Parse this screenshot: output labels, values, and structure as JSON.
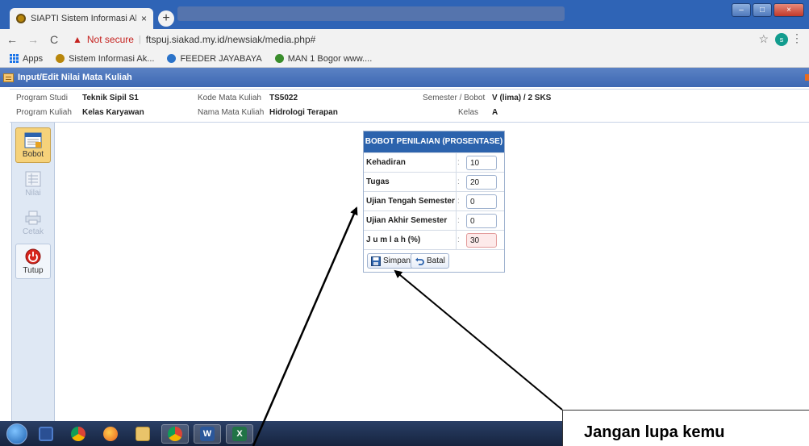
{
  "browser": {
    "tab_title": "SIAPTI Sistem Informasi Akadem",
    "tab_close": "×",
    "new_tab": "+",
    "not_secure": "Not secure",
    "url": "ftspuj.siakad.my.id/newsiak/media.php#",
    "profile_initial": "s",
    "window_buttons": {
      "minimize": "–",
      "maximize": "□",
      "close": "×"
    }
  },
  "bookmarks": [
    {
      "label": "Apps",
      "icon": "apps-icon"
    },
    {
      "label": "Sistem Informasi Ak...",
      "icon": "siakad-icon",
      "color": "#b8860b"
    },
    {
      "label": "FEEDER JAYABAYA",
      "icon": "feeder-icon",
      "color": "#2b73c9"
    },
    {
      "label": "MAN 1 Bogor www....",
      "icon": "man-icon",
      "color": "#3a8d2c"
    }
  ],
  "app": {
    "window_title": "Input/Edit Nilai Mata Kuliah"
  },
  "info": {
    "program_studi_label": "Program Studi",
    "program_studi": "Teknik Sipil S1",
    "program_kuliah_label": "Program Kuliah",
    "program_kuliah": "Kelas Karyawan",
    "kode_mk_label": "Kode Mata Kuliah",
    "kode_mk": "TS5022",
    "nama_mk_label": "Nama Mata Kuliah",
    "nama_mk": "Hidrologi Terapan",
    "semester_label": "Semester / Bobot",
    "semester": "V (lima) / 2 SKS",
    "kelas_label": "Kelas",
    "kelas": "A"
  },
  "sidebar": {
    "items": [
      {
        "label": "Bobot",
        "icon": "weight-icon",
        "state": "active"
      },
      {
        "label": "Nilai",
        "icon": "grades-icon",
        "state": "disabled"
      },
      {
        "label": "Cetak",
        "icon": "printer-icon",
        "state": "disabled"
      },
      {
        "label": "Tutup",
        "icon": "power-icon",
        "state": "normal"
      }
    ]
  },
  "bobot": {
    "header": "BOBOT PENILAIAN (PROSENTASE)",
    "colon": ":",
    "rows": [
      {
        "label": "Kehadiran",
        "value": "10"
      },
      {
        "label": "Tugas",
        "value": "20"
      },
      {
        "label": "Ujian Tengah Semester",
        "value": "0"
      },
      {
        "label": "Ujian Akhir Semester",
        "value": "0"
      }
    ],
    "total_label": "J u m l a h (%)",
    "total_value": "30",
    "save_label": "Simpan",
    "cancel_label": "Batal"
  },
  "annotation": {
    "callout_text": "Jangan lupa kemu"
  }
}
